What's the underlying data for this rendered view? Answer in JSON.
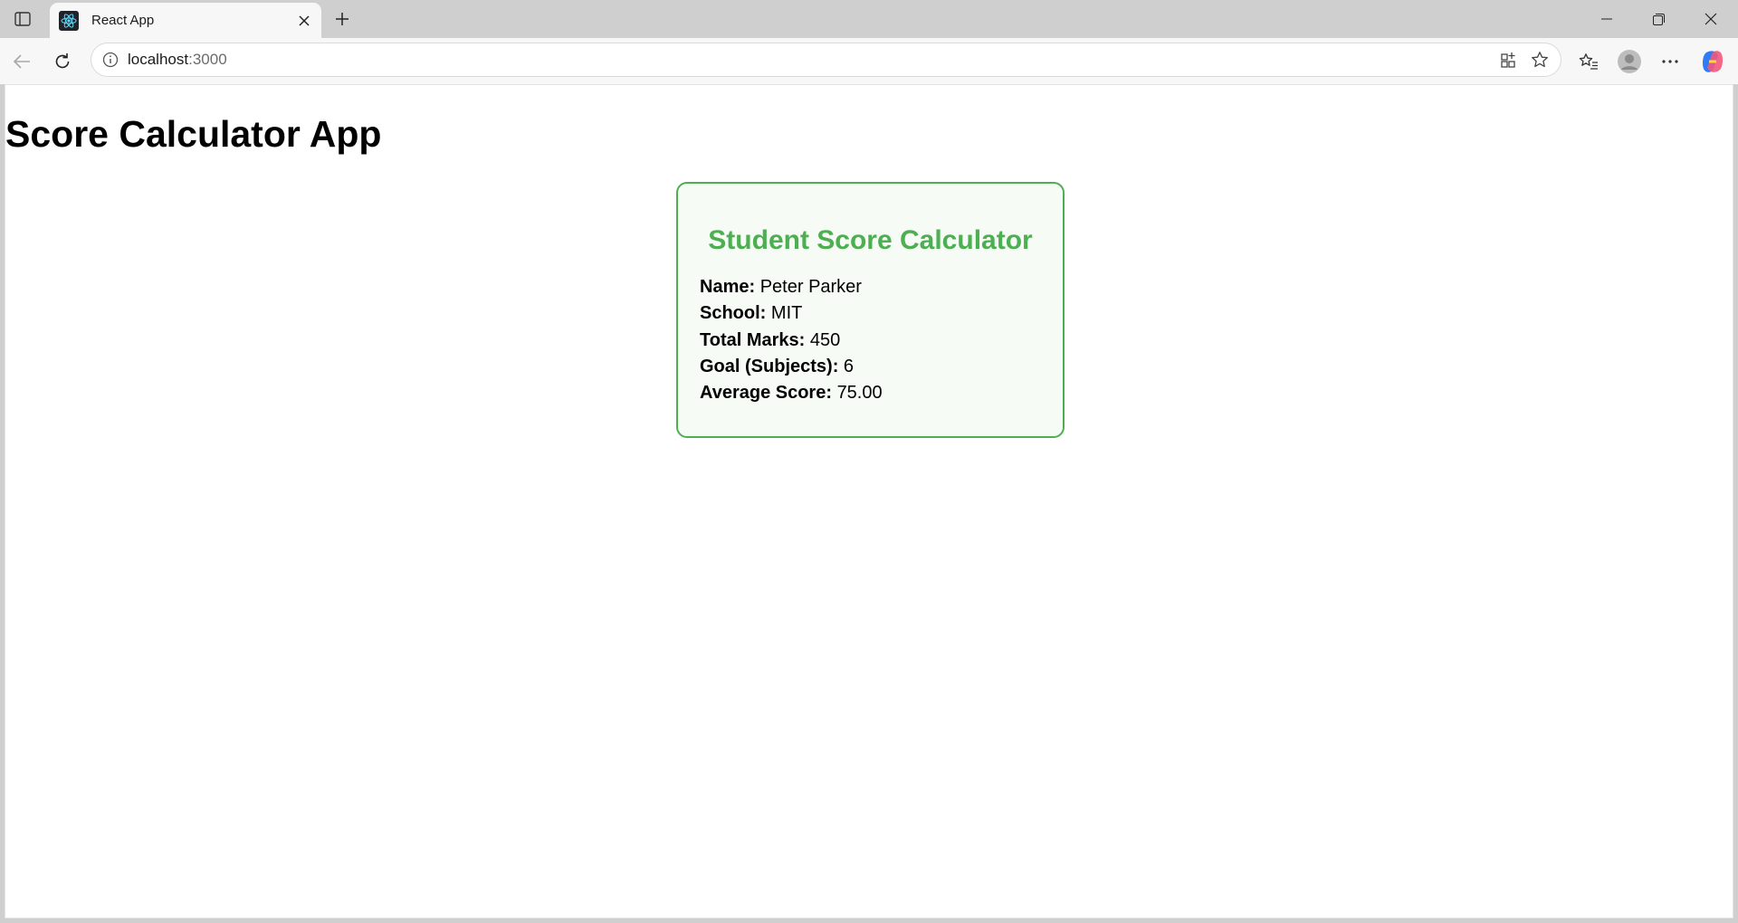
{
  "browser": {
    "tab": {
      "title": "React App"
    },
    "address": {
      "host": "localhost",
      "port": ":3000"
    }
  },
  "page": {
    "heading": "Score Calculator App",
    "card": {
      "title": "Student Score Calculator",
      "fields": [
        {
          "label": "Name:",
          "value": "Peter Parker"
        },
        {
          "label": "School:",
          "value": "MIT"
        },
        {
          "label": "Total Marks:",
          "value": "450"
        },
        {
          "label": "Goal (Subjects):",
          "value": "6"
        },
        {
          "label": "Average Score:",
          "value": "75.00"
        }
      ]
    }
  },
  "colors": {
    "accent": "#4caf50",
    "card_bg": "#f6fbf6"
  }
}
